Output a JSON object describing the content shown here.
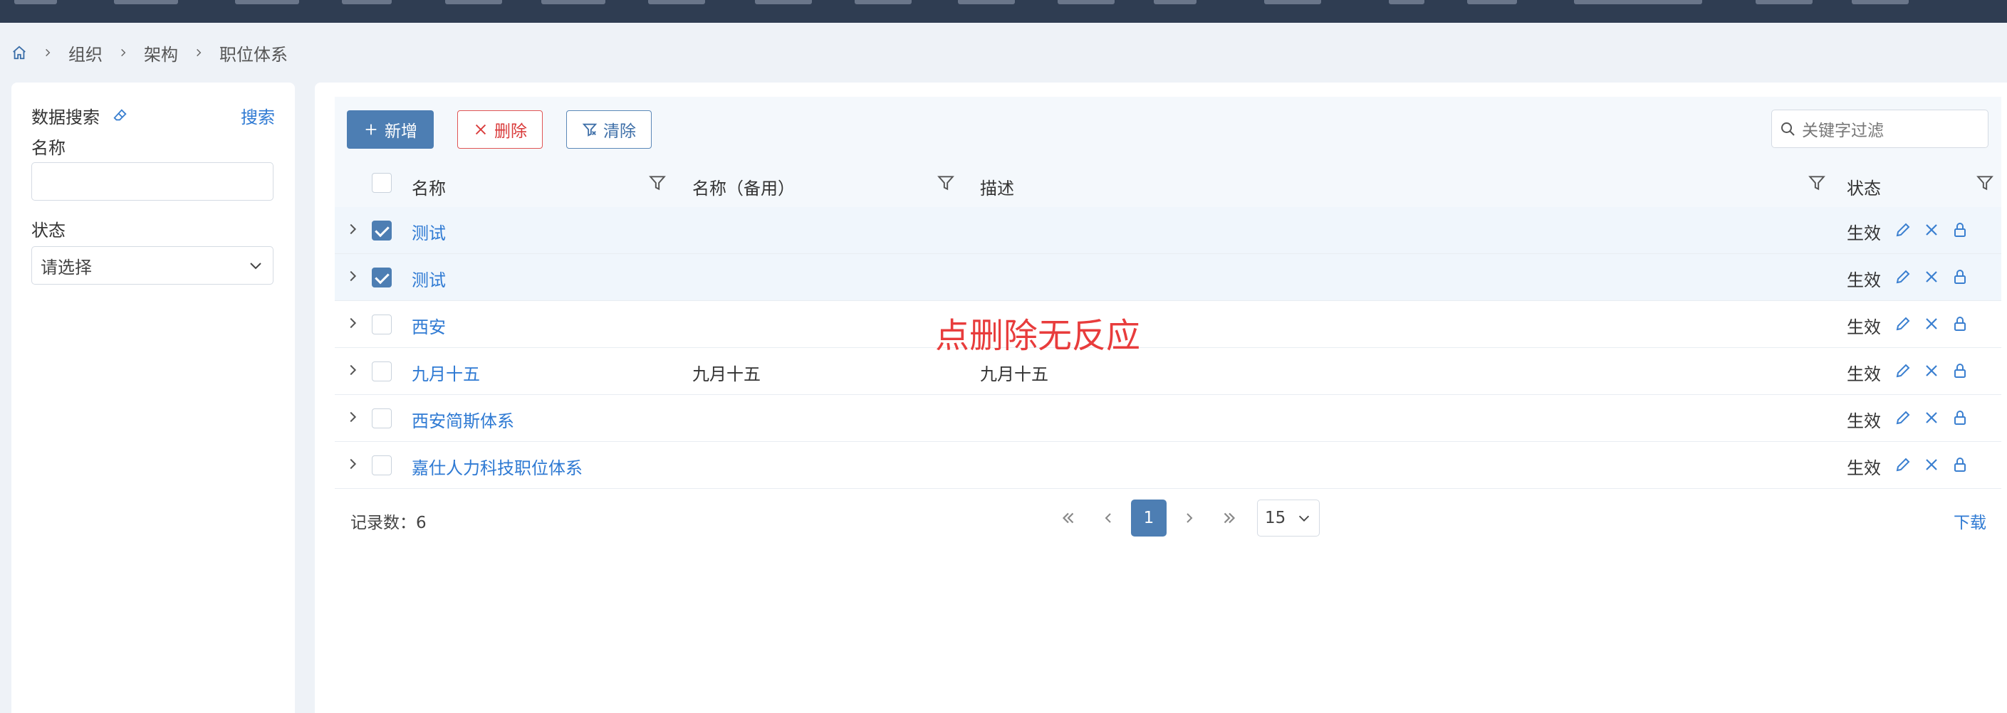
{
  "breadcrumb": {
    "items": [
      "组织",
      "架构",
      "职位体系"
    ]
  },
  "search_panel": {
    "title": "数据搜索",
    "search_label": "搜索",
    "name_label": "名称",
    "name_value": "",
    "status_label": "状态",
    "status_placeholder": "请选择"
  },
  "toolbar": {
    "add_label": "新增",
    "delete_label": "删除",
    "clear_label": "清除",
    "filter_placeholder": "关键字过滤"
  },
  "table": {
    "columns": [
      "名称",
      "名称（备用）",
      "描述",
      "状态"
    ],
    "rows": [
      {
        "name": "测试",
        "alt": "",
        "desc": "",
        "status": "生效",
        "checked": true
      },
      {
        "name": "测试",
        "alt": "",
        "desc": "",
        "status": "生效",
        "checked": true
      },
      {
        "name": "西安",
        "alt": "",
        "desc": "",
        "status": "生效",
        "checked": false
      },
      {
        "name": "九月十五",
        "alt": "九月十五",
        "desc": "九月十五",
        "status": "生效",
        "checked": false
      },
      {
        "name": "西安简斯体系",
        "alt": "",
        "desc": "",
        "status": "生效",
        "checked": false
      },
      {
        "name": "嘉仕人力科技职位体系",
        "alt": "",
        "desc": "",
        "status": "生效",
        "checked": false
      }
    ]
  },
  "annotation": "点删除无反应",
  "pagination": {
    "records_label": "记录数：",
    "records_count": "6",
    "current_page": "1",
    "page_size": "15",
    "download_label": "下载"
  },
  "colors": {
    "topbar": "#2f3d52",
    "primary": "#4d7eb3",
    "link": "#2f7ad3",
    "danger": "#d93a3a",
    "annotation": "#e83c3c"
  }
}
